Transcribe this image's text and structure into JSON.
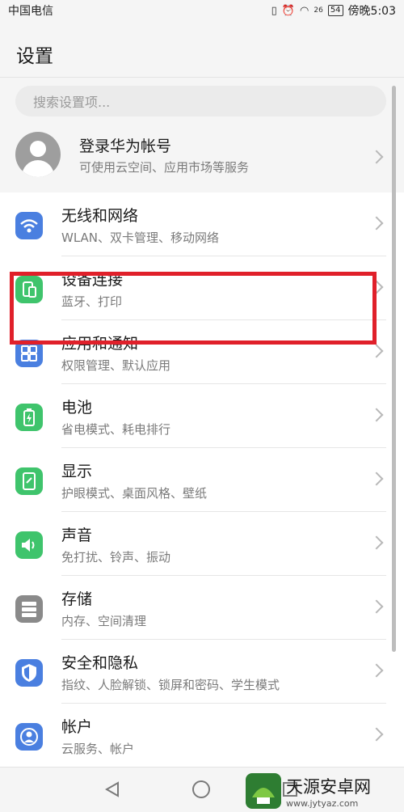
{
  "status": {
    "carrier": "中国电信",
    "battery": "54",
    "time": "傍晚5:03",
    "network": "26"
  },
  "header": {
    "title": "设置"
  },
  "search": {
    "placeholder": "搜索设置项..."
  },
  "account": {
    "title": "登录华为帐号",
    "subtitle": "可使用云空间、应用市场等服务"
  },
  "items": [
    {
      "title": "无线和网络",
      "subtitle": "WLAN、双卡管理、移动网络",
      "icon": "wifi-icon",
      "color": "#4a7fe0"
    },
    {
      "title": "设备连接",
      "subtitle": "蓝牙、打印",
      "icon": "device-connect-icon",
      "color": "#3fc46c"
    },
    {
      "title": "应用和通知",
      "subtitle": "权限管理、默认应用",
      "icon": "apps-icon",
      "color": "#4a7fe0"
    },
    {
      "title": "电池",
      "subtitle": "省电模式、耗电排行",
      "icon": "battery-icon",
      "color": "#3fc46c"
    },
    {
      "title": "显示",
      "subtitle": "护眼模式、桌面风格、壁纸",
      "icon": "display-icon",
      "color": "#3fc46c"
    },
    {
      "title": "声音",
      "subtitle": "免打扰、铃声、振动",
      "icon": "sound-icon",
      "color": "#3fc46c"
    },
    {
      "title": "存储",
      "subtitle": "内存、空间清理",
      "icon": "storage-icon",
      "color": "#8a8a8a"
    },
    {
      "title": "安全和隐私",
      "subtitle": "指纹、人脸解锁、锁屏和密码、学生模式",
      "icon": "shield-icon",
      "color": "#4a7fe0"
    },
    {
      "title": "帐户",
      "subtitle": "云服务、帐户",
      "icon": "account-icon",
      "color": "#4a7fe0"
    }
  ],
  "watermark": {
    "title": "天源安卓网",
    "url": "www.jytyaz.com"
  },
  "colors": {
    "highlight": "#e0202a"
  }
}
